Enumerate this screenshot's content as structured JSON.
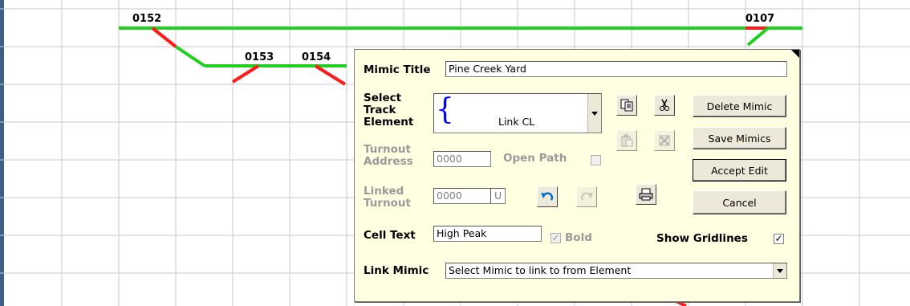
{
  "grid": {
    "cell_labels": [
      "0152",
      "0153",
      "0154",
      "0107"
    ],
    "colors": {
      "gridline": "#c8c8c8",
      "track_main": "#1fd11f",
      "track_turnout": "#ff1a1a",
      "left_bar": "#3d5f86"
    }
  },
  "editor": {
    "mimic_title_label": "Mimic Title",
    "mimic_title_value": "Pine Creek Yard",
    "select_track_label": "Select Track Element",
    "track_element_value": "Link CL",
    "turnout_address_label": "Turnout Address",
    "turnout_address_value": "0000",
    "open_path_label": "Open Path",
    "linked_turnout_label": "Linked Turnout",
    "linked_turnout_value": "0000",
    "linked_turnout_suffix": "U",
    "cell_text_label": "Cell Text",
    "cell_text_value": "High Peak",
    "bold_label": "Bold",
    "show_gridlines_label": "Show Gridlines",
    "link_mimic_label": "Link Mimic",
    "link_mimic_value": "Select Mimic to link to from Element",
    "buttons": {
      "delete_mimic": "Delete Mimic",
      "save_mimics": "Save Mimics",
      "accept_edit": "Accept Edit",
      "cancel": "Cancel"
    },
    "icons": [
      "copy-icon",
      "cut-icon",
      "paste-icon",
      "delete-element-icon",
      "undo-icon",
      "redo-icon",
      "print-icon"
    ]
  }
}
